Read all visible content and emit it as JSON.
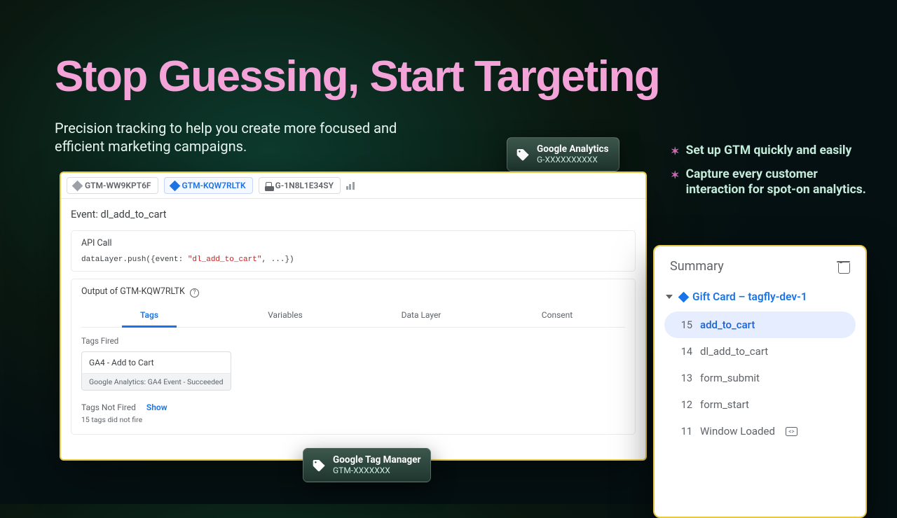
{
  "hero": {
    "title": "Stop Guessing, Start Targeting",
    "subtitle": "Precision tracking to help you create more focused and efficient marketing campaigns."
  },
  "features": [
    "Set up GTM quickly and easily",
    "Capture every customer interaction for spot-on analytics."
  ],
  "badge_ga": {
    "title": "Google Analytics",
    "id": "G-XXXXXXXXXX"
  },
  "badge_gtm": {
    "title": "Google Tag Manager",
    "id": "GTM-XXXXXXX"
  },
  "accounts": {
    "a0": "GTM-WW9KPT6F",
    "a1": "GTM-KQW7RLTK",
    "a2": "G-1N8L1E34SY"
  },
  "event": {
    "title": "Event: dl_add_to_cart",
    "api_label": "API Call",
    "code_pre": "dataLayer.push({event: ",
    "code_str": "\"dl_add_to_cart\"",
    "code_post": ", ...})",
    "output_label": "Output of GTM-KQW7RLTK"
  },
  "tabs": {
    "t0": "Tags",
    "t1": "Variables",
    "t2": "Data Layer",
    "t3": "Consent"
  },
  "tags": {
    "fired_label": "Tags Fired",
    "fired_name": "GA4 - Add to Cart",
    "fired_sub": "Google Analytics: GA4 Event - Succeeded",
    "not_fired_label": "Tags Not Fired",
    "show": "Show",
    "not_fired_count": "15 tags did not fire"
  },
  "summary": {
    "head": "Summary",
    "site": "Gift Card – tagfly-dev-1",
    "items": [
      {
        "n": "15",
        "name": "add_to_cart",
        "sel": true
      },
      {
        "n": "14",
        "name": "dl_add_to_cart"
      },
      {
        "n": "13",
        "name": "form_submit"
      },
      {
        "n": "12",
        "name": "form_start"
      },
      {
        "n": "11",
        "name": "Window Loaded",
        "icon": true
      }
    ]
  }
}
